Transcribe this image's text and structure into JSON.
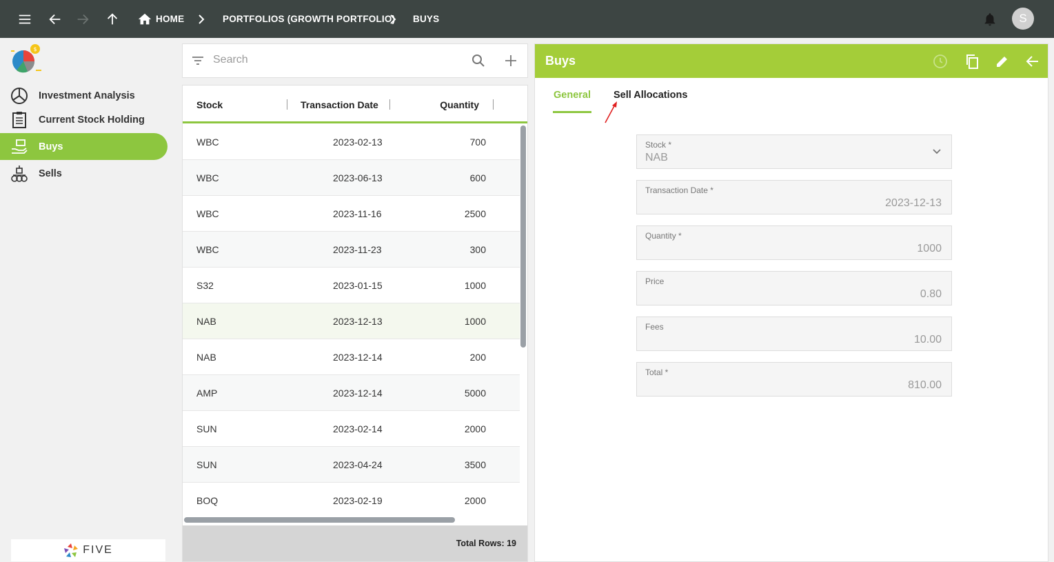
{
  "topbar": {
    "breadcrumbs": [
      "HOME",
      "PORTFOLIOS (GROWTH PORTFOLIO)",
      "BUYS"
    ],
    "avatar_initial": "S"
  },
  "sidebar": {
    "items": [
      {
        "label": "Investment Analysis",
        "icon": "pie-chart-icon"
      },
      {
        "label": "Current Stock Holding",
        "icon": "clipboard-icon"
      },
      {
        "label": "Buys",
        "icon": "hand-money-icon"
      },
      {
        "label": "Sells",
        "icon": "coins-stack-icon"
      }
    ],
    "active_index": 2,
    "footer_logo": "FIVE"
  },
  "search": {
    "placeholder": "Search"
  },
  "list": {
    "columns": [
      "Stock",
      "Transaction Date",
      "Quantity"
    ],
    "rows": [
      {
        "stock": "WBC",
        "date": "2023-02-13",
        "quantity": "700"
      },
      {
        "stock": "WBC",
        "date": "2023-06-13",
        "quantity": "600"
      },
      {
        "stock": "WBC",
        "date": "2023-11-16",
        "quantity": "2500"
      },
      {
        "stock": "WBC",
        "date": "2023-11-23",
        "quantity": "300"
      },
      {
        "stock": "S32",
        "date": "2023-01-15",
        "quantity": "1000"
      },
      {
        "stock": "NAB",
        "date": "2023-12-13",
        "quantity": "1000"
      },
      {
        "stock": "NAB",
        "date": "2023-12-14",
        "quantity": "200"
      },
      {
        "stock": "AMP",
        "date": "2023-12-14",
        "quantity": "5000"
      },
      {
        "stock": "SUN",
        "date": "2023-02-14",
        "quantity": "2000"
      },
      {
        "stock": "SUN",
        "date": "2023-04-24",
        "quantity": "3500"
      },
      {
        "stock": "BOQ",
        "date": "2023-02-19",
        "quantity": "2000"
      }
    ],
    "selected_index": 5,
    "footer": "Total Rows: 19"
  },
  "form": {
    "title": "Buys",
    "tabs": [
      "General",
      "Sell Allocations"
    ],
    "active_tab": 0,
    "fields": [
      {
        "label": "Stock *",
        "value": "NAB"
      },
      {
        "label": "Transaction Date *",
        "value": "2023-12-13"
      },
      {
        "label": "Quantity *",
        "value": "1000"
      },
      {
        "label": "Price",
        "value": "0.80"
      },
      {
        "label": "Fees",
        "value": "10.00"
      },
      {
        "label": "Total *",
        "value": "810.00"
      }
    ]
  },
  "colors": {
    "topbar": "#3d4543",
    "accent": "#8dc63f",
    "form_header": "#a4cd39",
    "annotation_arrow": "#e02020"
  }
}
